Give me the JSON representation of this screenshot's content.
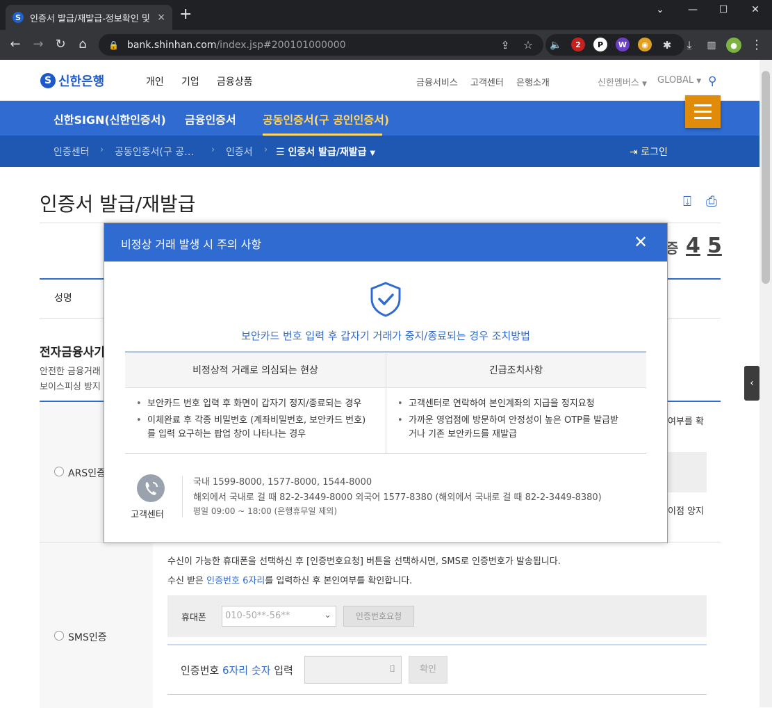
{
  "browser": {
    "tab_title": "인증서 발급/재발급-정보확인 및",
    "tab_close": "×",
    "new_tab": "+",
    "url_host": "bank.shinhan.com",
    "url_path": "/index.jsp#200101000000",
    "ext_badge": "2"
  },
  "site": {
    "logo_text": "신한은행",
    "logo_mark": "S",
    "gnb": [
      "개인",
      "기업",
      "금융상품"
    ],
    "util": [
      "금융서비스",
      "고객센터",
      "은행소개"
    ],
    "members": "신한멤버스",
    "global": "GLOBAL",
    "band": [
      "신한SIGN(신한인증서)",
      "금융인증서",
      "공동인증서(구 공인인증서)"
    ],
    "crumbs": [
      "인증센터",
      "공동인증서(구 공…",
      "인증서",
      "인증서 발급/재발급"
    ],
    "login": "로그인",
    "accent": "#2f6bd0"
  },
  "page": {
    "title": "인증서 발급/재발급",
    "steps": [
      "4",
      "5"
    ],
    "step_partial": "증",
    "name_label": "성명",
    "section_title": "전자금융사기",
    "section_desc": [
      "안전한 금융거래",
      "보이스피싱 방지"
    ],
    "ars_label": "ARS인증",
    "ars_side_1": "여부를 확",
    "ars_side_2": "이점 양지",
    "sms_label": "SMS인증",
    "sms_line1": "수신이 가능한 휴대폰을 선택하신 후 [인증번호요청] 버튼을 선택하시면, SMS로 인증번호가 발송됩니다.",
    "sms_line2_a": "수신 받은 ",
    "sms_line2_b": "인증번호 6자리",
    "sms_line2_c": "를 입력하신 후 본인여부를 확인합니다.",
    "phone_label": "휴대폰",
    "phone_value": "010-50**-56**",
    "request_btn": "인증번호요청",
    "code_label_a": "인증번호 ",
    "code_label_b": "6자리 숫자",
    "code_label_c": " 입력",
    "confirm_btn": "확인"
  },
  "modal": {
    "title": "비정상 거래 발생 시 주의 사항",
    "subtitle": "보안카드 번호 입력 후 갑자기 거래가 중지/종료되는 경우 조치방법",
    "col1_head": "비정상적 거래로 의심되는 현상",
    "col2_head": "긴급조치사항",
    "col1_items": [
      "보안카드 번호 입력 후 화면이 갑자기 정지/종료되는 경우",
      "이체완료 후 각종 비밀번호 (계좌비밀번호, 보안카드 번호)",
      "를 입력 요구하는 팝업 창이 나타나는 경우"
    ],
    "col2_items": [
      "고객센터로 연락하여 본인계좌의 지급을 정지요청",
      "가까운 영업점에 방문하여 안정성이 높은 OTP를 발급받",
      "거나 기존 보안카드를 재발급"
    ],
    "bullet": "•",
    "cs_label": "고객센터",
    "cs_lines": [
      "국내 1599-8000, 1577-8000, 1544-8000",
      "해외에서 국내로 걸 때 82-2-3449-8000   외국어 1577-8380 (해외에서 국내로 걸 때 82-2-3449-8380)",
      "평일 09:00 ~ 18:00 (은행휴무일 제외)"
    ]
  }
}
